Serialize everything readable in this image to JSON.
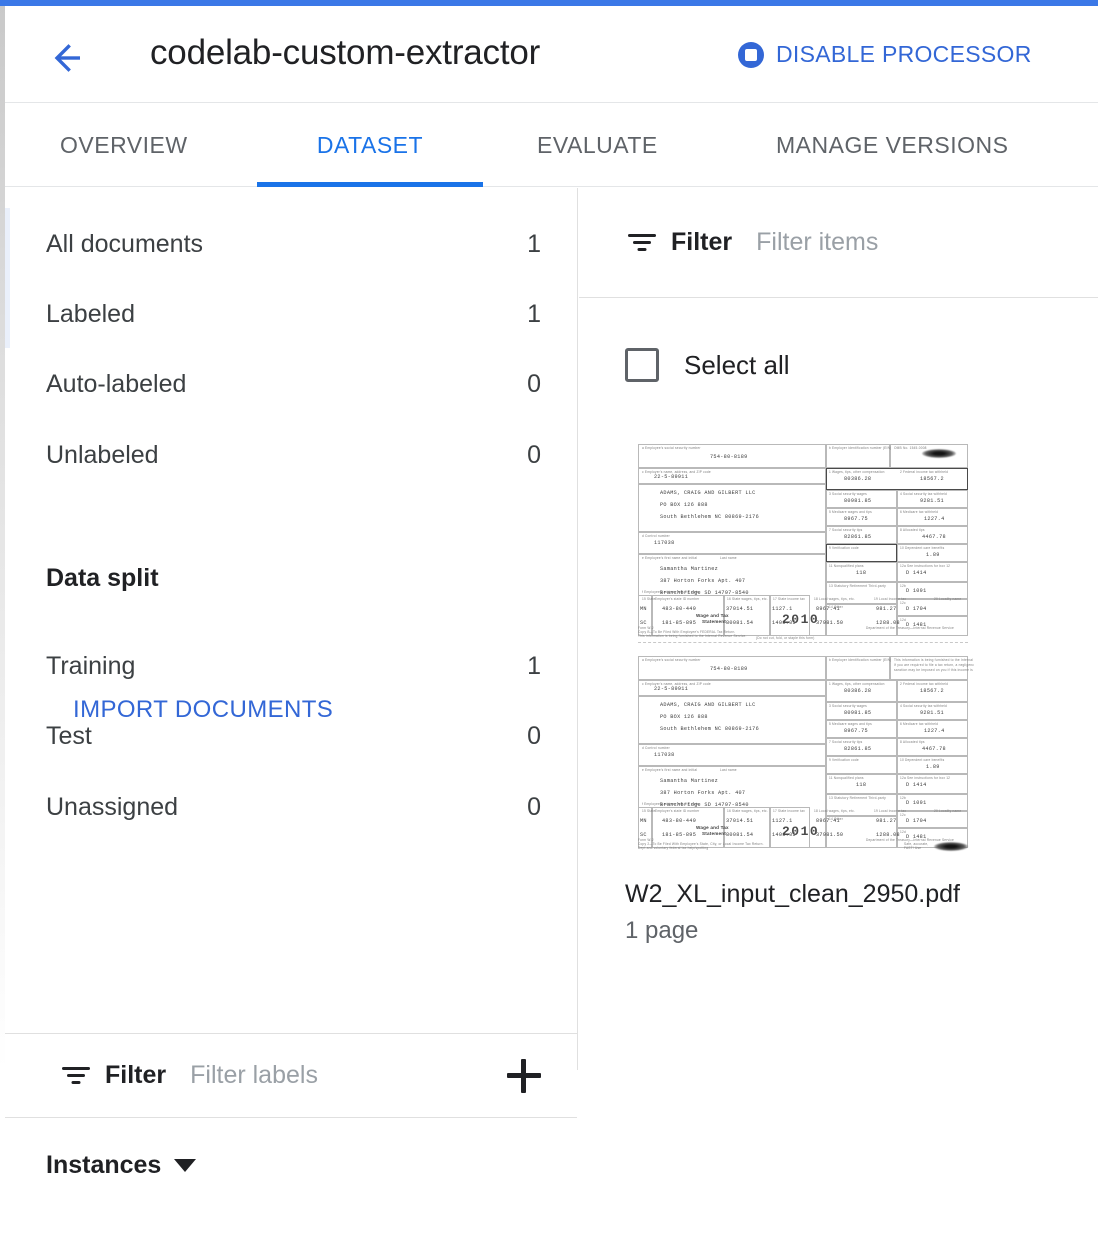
{
  "theme": {
    "accent_blue": "#1a73e8",
    "link_blue": "#3367d6",
    "top_bar_blue": "#3b78e7",
    "text_primary": "#202124",
    "text_secondary": "#5f6368",
    "placeholder": "#9aa0a6",
    "divider": "#e0e0e0",
    "selected_row_tint": "#eaf0fb"
  },
  "header": {
    "back_icon": "arrow-back-icon",
    "title": "codelab-custom-extractor",
    "action": {
      "icon": "stop-circle-icon",
      "label": "DISABLE PROCESSOR"
    }
  },
  "tabs": [
    {
      "label": "OVERVIEW",
      "active": false
    },
    {
      "label": "DATASET",
      "active": true
    },
    {
      "label": "EVALUATE",
      "active": false
    },
    {
      "label": "MANAGE VERSIONS",
      "active": false
    }
  ],
  "sidebar": {
    "document_counts": [
      {
        "label": "All documents",
        "count": "1",
        "selected": true
      },
      {
        "label": "Labeled",
        "count": "1",
        "selected": false
      },
      {
        "label": "Auto-labeled",
        "count": "0",
        "selected": false
      },
      {
        "label": "Unlabeled",
        "count": "0",
        "selected": false
      }
    ],
    "import_button": "IMPORT DOCUMENTS",
    "data_split_heading": "Data split",
    "data_split": [
      {
        "label": "Training",
        "count": "1"
      },
      {
        "label": "Test",
        "count": "0"
      },
      {
        "label": "Unassigned",
        "count": "0"
      }
    ],
    "label_filter": {
      "icon": "filter-list-icon",
      "word": "Filter",
      "placeholder": "Filter labels",
      "value": "",
      "add_icon": "plus-icon"
    },
    "instances": {
      "label": "Instances",
      "caret_icon": "chevron-down-icon",
      "expanded": false
    }
  },
  "content": {
    "item_filter": {
      "icon": "filter-list-icon",
      "word": "Filter",
      "placeholder": "Filter items",
      "value": ""
    },
    "select_all": {
      "label": "Select all",
      "checked": false
    },
    "documents": [
      {
        "name": "W2_XL_input_clean_2950.pdf",
        "pages": "1 page",
        "thumbnail_alt": "w2-tax-form-thumbnail"
      }
    ]
  },
  "thumbnail_form": {
    "year": "2010",
    "title_line1": "Wage and Tax",
    "title_line2": "Statement",
    "header_labels": [
      "Employee's social security number",
      "OMB No. 1545-0008",
      "Safe, accurate,",
      "FAST! Use",
      "Visit the IRS Website"
    ],
    "value_ssn": "754-80-8189",
    "value_ein": "22-5-89911",
    "employer_lines": [
      "ADAMS, CRAIG AND GILBERT LLC",
      "PO BOX 126 888",
      "South Bethlehem  NC  80869-2176"
    ],
    "control_number": "117038",
    "employee_lines": [
      "Samantha   Martinez",
      "387 Horton Forks Apt. 407",
      "Branchbridge   SD    14797-8540"
    ],
    "box_values_left": [
      "80386.28",
      "80981.85",
      "8967.75",
      "82861.85"
    ],
    "box_values_right": [
      "18567.2",
      "9281.51",
      "1227.4",
      "4467.78",
      "1.89"
    ],
    "state_rows": [
      [
        "MN",
        "483-80-449",
        "37014.51",
        "1127.1",
        "8967.41",
        "981.27"
      ],
      [
        "SC",
        "181-85-895",
        "80081.54",
        "1401.05",
        "37981.50",
        "1288.08"
      ]
    ],
    "footer_lines": [
      "Form W-2",
      "Copy B—To Be Filed With Employee's FEDERAL Tax Return.",
      "This information is being furnished to the Internal Revenue Service."
    ],
    "dept_line": "Department of the Treasury—Internal Revenue Service"
  }
}
